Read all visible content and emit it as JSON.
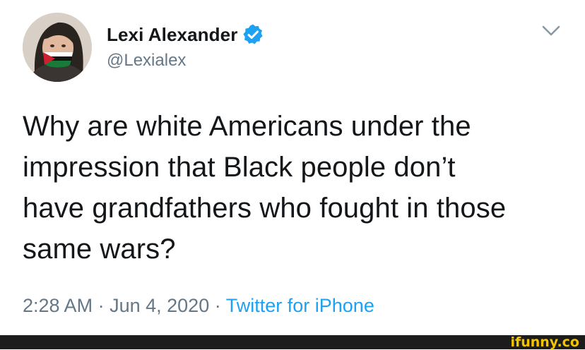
{
  "tweet": {
    "display_name": "Lexi Alexander",
    "handle": "@Lexialex",
    "verified": true,
    "verified_icon": "verified-badge-icon",
    "menu_icon": "chevron-down-icon",
    "lines": [
      "Why are white Americans under the",
      "impression that Black people don’t",
      "have grandfathers who fought in those",
      "same wars?"
    ],
    "time": "2:28 AM",
    "separator": "·",
    "date": "Jun 4, 2020",
    "source": "Twitter for iPhone"
  },
  "watermark": {
    "text": "ifunny.co"
  },
  "colors": {
    "text": "#14171a",
    "secondary": "#657786",
    "accent": "#1da1f2",
    "watermark": "#f5c400",
    "footer": "#1c1c1c"
  }
}
